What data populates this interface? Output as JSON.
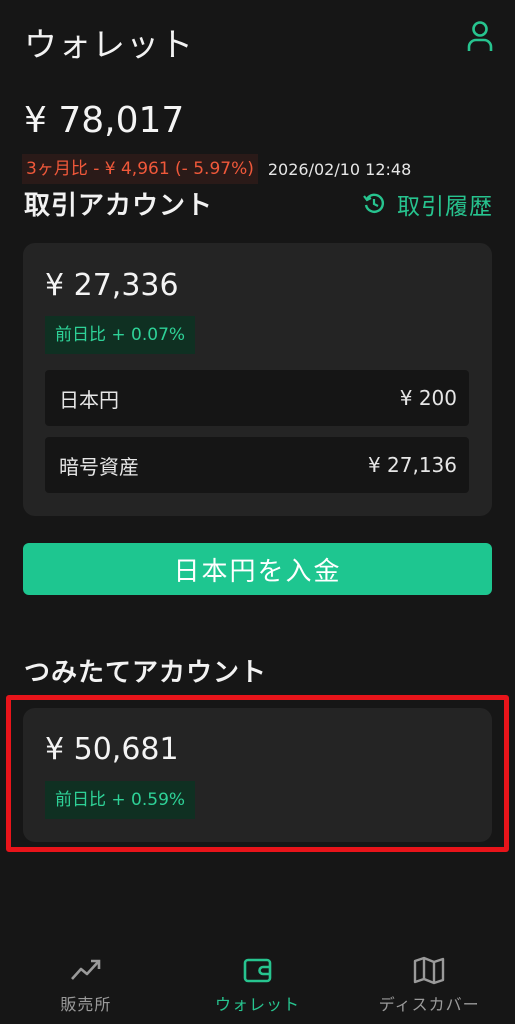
{
  "header": {
    "title": "ウォレット",
    "user_icon": "user-icon"
  },
  "summary": {
    "total": "¥ 78,017",
    "change": "3ヶ月比 - ¥ 4,961 (- 5.97%)",
    "timestamp": "2026/02/10 12:48",
    "colors": {
      "down": "#f0583a",
      "up": "#2ed197",
      "accent": "#27c48f"
    }
  },
  "trading": {
    "title": "取引アカウント",
    "history_label": "取引履歴",
    "amount": "¥ 27,336",
    "day_change": "前日比 + 0.07%",
    "rows": [
      {
        "label": "日本円",
        "value": "¥ 200"
      },
      {
        "label": "暗号資産",
        "value": "¥ 27,136"
      }
    ]
  },
  "deposit_button": "日本円を入金",
  "tsumitate": {
    "title": "つみたてアカウント",
    "amount": "¥ 50,681",
    "day_change": "前日比 + 0.59%"
  },
  "nav": [
    {
      "label": "販売所",
      "icon": "trend-icon",
      "active": false
    },
    {
      "label": "ウォレット",
      "icon": "wallet-icon",
      "active": true
    },
    {
      "label": "ディスカバー",
      "icon": "map-icon",
      "active": false
    }
  ]
}
